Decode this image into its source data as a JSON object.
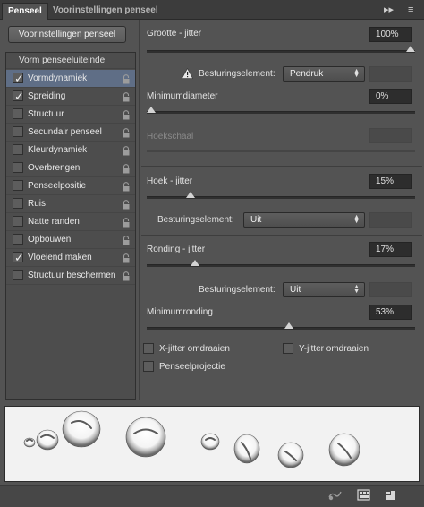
{
  "tabs": [
    {
      "label": "Penseel",
      "active": true
    },
    {
      "label": "Voorinstellingen penseel",
      "active": false
    }
  ],
  "header_controls": {
    "collapse": "▸▸",
    "menu": "≡"
  },
  "presets_button": "Voorinstellingen penseel",
  "brush_list": {
    "header": "Vorm penseeluiteinde",
    "items": [
      {
        "label": "Vormdynamiek",
        "checked": true,
        "selected": true
      },
      {
        "label": "Spreiding",
        "checked": true,
        "selected": false
      },
      {
        "label": "Structuur",
        "checked": false,
        "selected": false
      },
      {
        "label": "Secundair penseel",
        "checked": false,
        "selected": false
      },
      {
        "label": "Kleurdynamiek",
        "checked": false,
        "selected": false
      },
      {
        "label": "Overbrengen",
        "checked": false,
        "selected": false
      },
      {
        "label": "Penseelpositie",
        "checked": false,
        "selected": false
      },
      {
        "label": "Ruis",
        "checked": false,
        "selected": false
      },
      {
        "label": "Natte randen",
        "checked": false,
        "selected": false
      },
      {
        "label": "Opbouwen",
        "checked": false,
        "selected": false
      },
      {
        "label": "Vloeiend maken",
        "checked": true,
        "selected": false
      },
      {
        "label": "Structuur beschermen",
        "checked": false,
        "selected": false
      }
    ]
  },
  "size_jitter": {
    "label": "Grootte - jitter",
    "value": "100%",
    "level": 1.0
  },
  "size_control": {
    "label": "Besturingselement:",
    "value": "Pendruk"
  },
  "min_diameter": {
    "label": "Minimumdiameter",
    "value": "0%",
    "level": 0.0
  },
  "tilt_scale": {
    "label": "Hoekschaal"
  },
  "angle_jitter": {
    "label": "Hoek - jitter",
    "value": "15%",
    "level": 0.15
  },
  "angle_control": {
    "label": "Besturingselement:",
    "value": "Uit"
  },
  "roundness_jitter": {
    "label": "Ronding - jitter",
    "value": "17%",
    "level": 0.17
  },
  "roundness_control": {
    "label": "Besturingselement:",
    "value": "Uit"
  },
  "min_roundness": {
    "label": "Minimumronding",
    "value": "53%",
    "level": 0.53
  },
  "flip_x": {
    "label": "X-jitter omdraaien",
    "checked": false
  },
  "flip_y": {
    "label": "Y-jitter omdraaien",
    "checked": false
  },
  "brush_projection": {
    "label": "Penseelprojectie",
    "checked": false
  },
  "icons": {
    "warning": "warning-icon",
    "lock": "lock-icon",
    "toggle_preview": "brush-preview-icon",
    "grid": "grid-icon",
    "new_preset": "new-preset-icon"
  }
}
